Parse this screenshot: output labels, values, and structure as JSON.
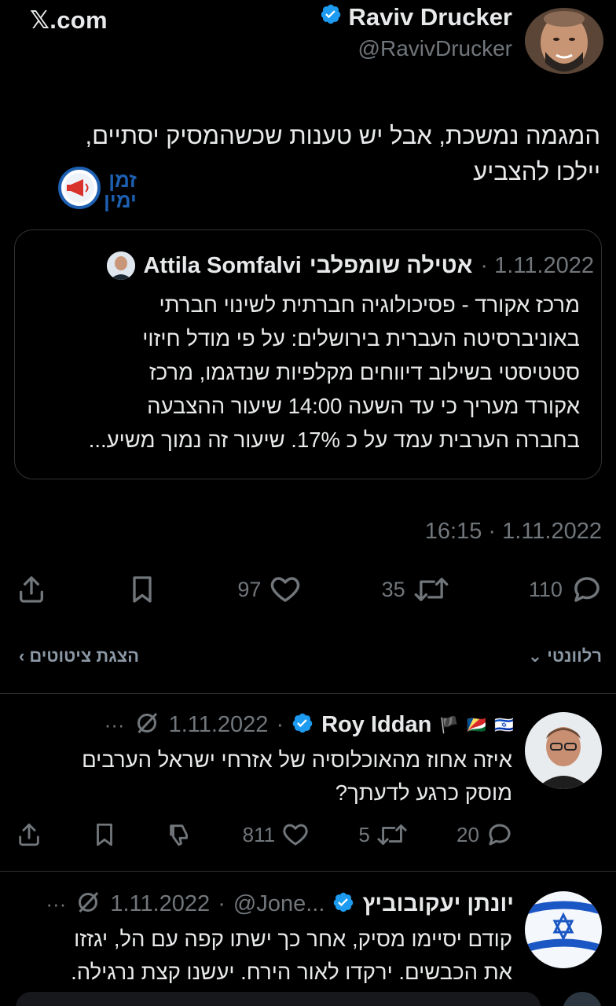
{
  "header": {
    "brand": "𝕏.com",
    "author_name": "Raviv Drucker",
    "author_handle": "@RavivDrucker"
  },
  "tweet": {
    "text_line1": "המגמה נמשכת, אבל יש טענות שכשהמסיק יסתיים,",
    "text_line2": "יילכו להצביע",
    "badge_line1": "זמן",
    "badge_line2": "ימין"
  },
  "quote": {
    "name": "Attila שומפלבי אטילה",
    "name_hebrew": "אטילה שומפלבי",
    "name_latin": "Attila Somfalvi",
    "date": "1.11.2022",
    "lines": [
      "מרכז אקורד - פסיכולוגיה חברתית לשינוי חברתי",
      "באוניברסיטה העברית  בירושלים: על פי מודל חיזוי",
      "סטטיסטי בשילוב דיווחים מקלפיות שנדגמו, מרכז",
      "אקורד מעריך כי עד השעה 14:00 שיעור ההצבעה",
      "בחברה הערבית עמד על כ 17%. שיעור זה נמוך משיע..."
    ]
  },
  "meta": {
    "timestamp": "16:15 · 1.11.2022"
  },
  "actions": {
    "likes": "97",
    "retweets": "35",
    "replies": "110"
  },
  "filters": {
    "quotes_label": "הצגת ציטוטים",
    "relevance_label": "רלוונטי"
  },
  "replies": [
    {
      "name": "Roy Iddan",
      "date": "1.11.2022",
      "line1": "איזה אחוז מהאוכלוסיה של אזרחי ישראל הערבים",
      "line2": "מוסק כרגע לדעתך?",
      "likes": "811",
      "retweets": "5",
      "replies": "20"
    },
    {
      "name": "יונתן יעקובוביץ",
      "handle": "@Jone...",
      "date": "1.11.2022",
      "line1": "קודם יסיימו מסיק, אחר כך ישתו קפה עם הל, יגזזו",
      "line2": "את הכבשים. ירקדו לאור הירח. יעשנו קצת נרגילה."
    }
  ],
  "colors": {
    "background": "#000000",
    "text": "#e7e9ea",
    "muted": "#71767b",
    "verified": "#1d9bf0",
    "border": "#2f3336"
  }
}
